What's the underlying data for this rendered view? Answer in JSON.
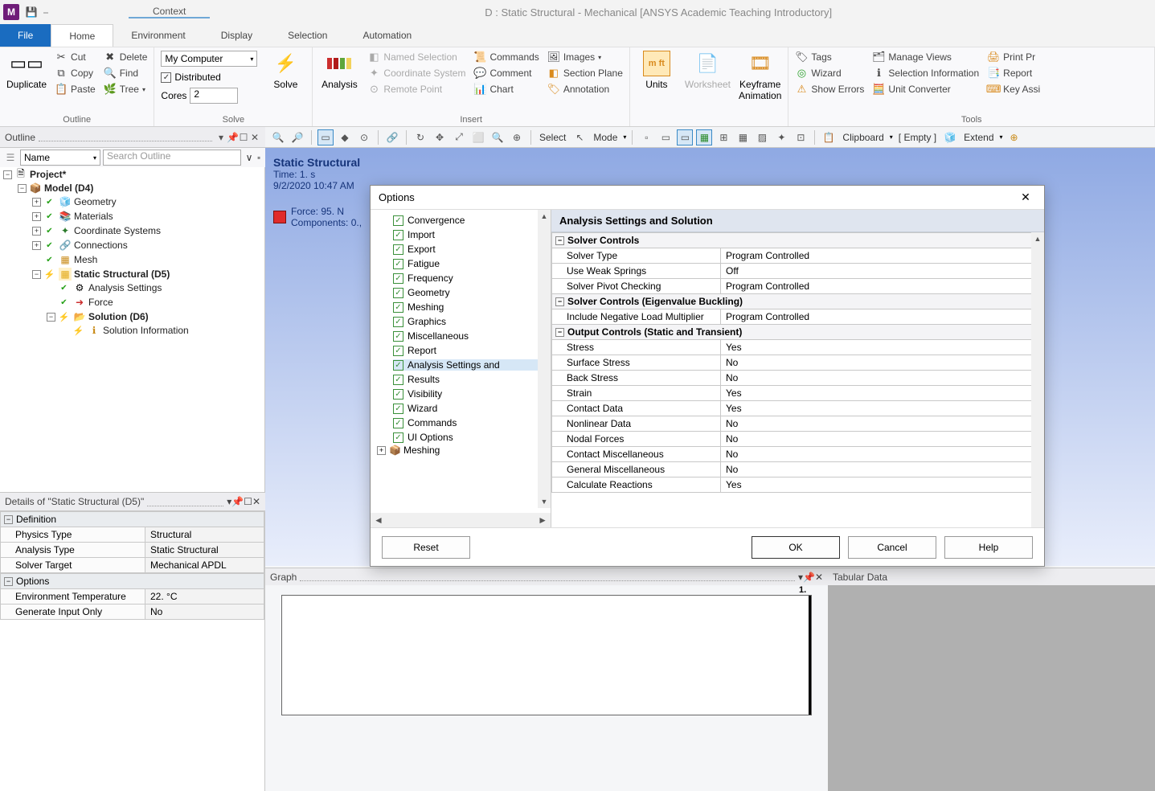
{
  "window_title": "D : Static Structural - Mechanical [ANSYS Academic Teaching Introductory]",
  "context_tab_label": "Context",
  "tabs": {
    "file": "File",
    "home": "Home",
    "environment": "Environment",
    "display": "Display",
    "selection": "Selection",
    "automation": "Automation"
  },
  "ribbon": {
    "outline": {
      "duplicate": "Duplicate",
      "cut": "Cut",
      "copy": "Copy",
      "paste": "Paste",
      "delete": "Delete",
      "find": "Find",
      "tree": "Tree",
      "label": "Outline"
    },
    "solve": {
      "compute_value": "My Computer",
      "distributed": "Distributed",
      "cores_label": "Cores",
      "cores_value": "2",
      "solve": "Solve",
      "label": "Solve"
    },
    "insert": {
      "analysis": "Analysis",
      "named_selection": "Named Selection",
      "coord_sys": "Coordinate System",
      "remote_point": "Remote Point",
      "commands": "Commands",
      "comment": "Comment",
      "chart": "Chart",
      "images": "Images",
      "section_plane": "Section Plane",
      "annotation": "Annotation",
      "label": "Insert"
    },
    "units_group": {
      "units": "Units",
      "worksheet": "Worksheet",
      "keyframe": "Keyframe\nAnimation"
    },
    "tools": {
      "tags": "Tags",
      "wizard": "Wizard",
      "show_errors": "Show Errors",
      "manage_views": "Manage Views",
      "selection_info": "Selection Information",
      "unit_converter": "Unit Converter",
      "print_pre": "Print Pr",
      "report": "Report",
      "key_assi": "Key Assi",
      "label": "Tools"
    }
  },
  "quickbar": {
    "select": "Select",
    "mode": "Mode",
    "clipboard": "Clipboard",
    "empty": "[ Empty ]",
    "extend": "Extend"
  },
  "outline_panel": {
    "title": "Outline",
    "name_label": "Name",
    "search_placeholder": "Search Outline",
    "tree": {
      "project": "Project*",
      "model": "Model (D4)",
      "geometry": "Geometry",
      "materials": "Materials",
      "coord": "Coordinate Systems",
      "connections": "Connections",
      "mesh": "Mesh",
      "static": "Static Structural (D5)",
      "analysis_settings": "Analysis Settings",
      "force": "Force",
      "solution": "Solution (D6)",
      "solution_info": "Solution Information"
    }
  },
  "viewport": {
    "title": "Static Structural",
    "time": "Time: 1. s",
    "date": "9/2/2020 10:47 AM",
    "force": "Force: 95. N",
    "components": "Components: 0.,"
  },
  "details": {
    "title": "Details of \"Static Structural (D5)\"",
    "cat1": "Definition",
    "rows1": [
      {
        "k": "Physics Type",
        "v": "Structural"
      },
      {
        "k": "Analysis Type",
        "v": "Static Structural"
      },
      {
        "k": "Solver Target",
        "v": "Mechanical APDL"
      }
    ],
    "cat2": "Options",
    "rows2": [
      {
        "k": "Environment Temperature",
        "v": "22. °C"
      },
      {
        "k": "Generate Input Only",
        "v": "No"
      }
    ]
  },
  "graph": {
    "title": "Graph",
    "tick": "1."
  },
  "tabular": {
    "title": "Tabular Data"
  },
  "options_dialog": {
    "title": "Options",
    "tree_items": [
      "Convergence",
      "Import",
      "Export",
      "Fatigue",
      "Frequency",
      "Geometry",
      "Meshing",
      "Graphics",
      "Miscellaneous",
      "Report",
      "Analysis Settings and",
      "Results",
      "Visibility",
      "Wizard",
      "Commands",
      "UI Options"
    ],
    "tree_group": "Meshing",
    "right_title": "Analysis Settings and Solution",
    "cats": [
      {
        "name": "Solver Controls",
        "rows": [
          {
            "k": "Solver Type",
            "v": "Program Controlled"
          },
          {
            "k": "Use Weak Springs",
            "v": "Off"
          },
          {
            "k": "Solver Pivot Checking",
            "v": "Program Controlled"
          }
        ]
      },
      {
        "name": "Solver Controls (Eigenvalue Buckling)",
        "rows": [
          {
            "k": "Include Negative Load Multiplier",
            "v": "Program Controlled"
          }
        ]
      },
      {
        "name": "Output Controls (Static and Transient)",
        "rows": [
          {
            "k": "Stress",
            "v": "Yes"
          },
          {
            "k": "Surface Stress",
            "v": "No"
          },
          {
            "k": "Back Stress",
            "v": "No"
          },
          {
            "k": "Strain",
            "v": "Yes"
          },
          {
            "k": "Contact Data",
            "v": "Yes"
          },
          {
            "k": "Nonlinear Data",
            "v": "No"
          },
          {
            "k": "Nodal Forces",
            "v": "No"
          },
          {
            "k": "Contact Miscellaneous",
            "v": "No"
          },
          {
            "k": "General Miscellaneous",
            "v": "No"
          },
          {
            "k": "Calculate Reactions",
            "v": "Yes"
          }
        ]
      }
    ],
    "buttons": {
      "reset": "Reset",
      "ok": "OK",
      "cancel": "Cancel",
      "help": "Help"
    }
  }
}
